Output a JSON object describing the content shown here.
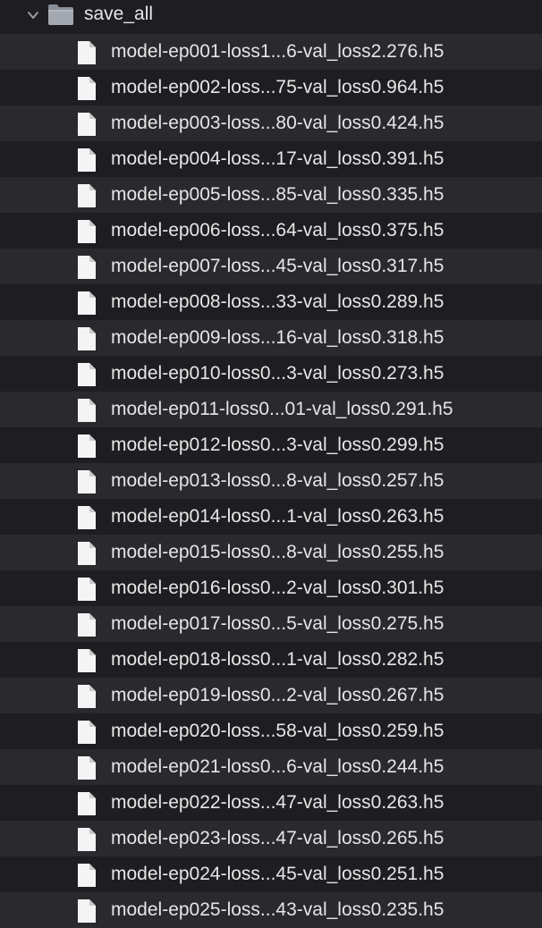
{
  "folder": {
    "name": "save_all",
    "expanded": true,
    "chevron_icon": "chevron-down-icon",
    "folder_icon": "folder-icon"
  },
  "files": [
    "model-ep001-loss1...6-val_loss2.276.h5",
    "model-ep002-loss...75-val_loss0.964.h5",
    "model-ep003-loss...80-val_loss0.424.h5",
    "model-ep004-loss...17-val_loss0.391.h5",
    "model-ep005-loss...85-val_loss0.335.h5",
    "model-ep006-loss...64-val_loss0.375.h5",
    "model-ep007-loss...45-val_loss0.317.h5",
    "model-ep008-loss...33-val_loss0.289.h5",
    "model-ep009-loss...16-val_loss0.318.h5",
    "model-ep010-loss0...3-val_loss0.273.h5",
    "model-ep011-loss0...01-val_loss0.291.h5",
    "model-ep012-loss0...3-val_loss0.299.h5",
    "model-ep013-loss0...8-val_loss0.257.h5",
    "model-ep014-loss0...1-val_loss0.263.h5",
    "model-ep015-loss0...8-val_loss0.255.h5",
    "model-ep016-loss0...2-val_loss0.301.h5",
    "model-ep017-loss0...5-val_loss0.275.h5",
    "model-ep018-loss0...1-val_loss0.282.h5",
    "model-ep019-loss0...2-val_loss0.267.h5",
    "model-ep020-loss...58-val_loss0.259.h5",
    "model-ep021-loss0...6-val_loss0.244.h5",
    "model-ep022-loss...47-val_loss0.263.h5",
    "model-ep023-loss...47-val_loss0.265.h5",
    "model-ep024-loss...45-val_loss0.251.h5",
    "model-ep025-loss...43-val_loss0.235.h5"
  ],
  "file_icon": "document-icon",
  "colors": {
    "background": "#1e1e22",
    "row_alt": "#29292e",
    "text": "#e6e6e6"
  }
}
